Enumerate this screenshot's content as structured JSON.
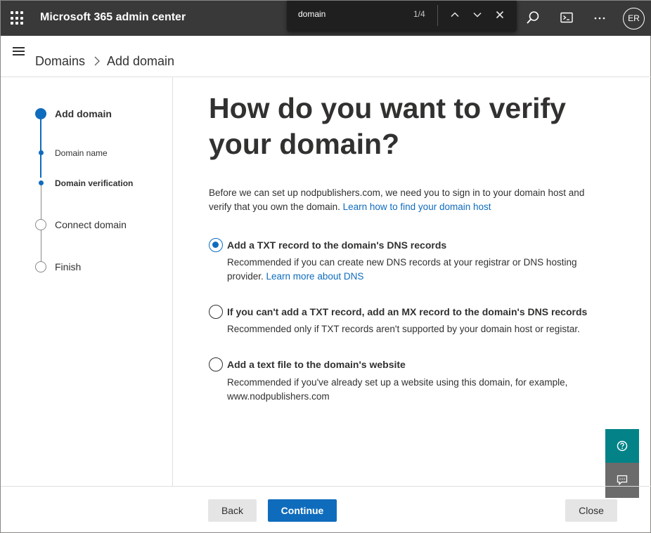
{
  "app": {
    "title": "Microsoft 365 admin center",
    "avatar_initials": "ER"
  },
  "find_bar": {
    "query": "domain",
    "count": "1/4"
  },
  "topbar_icons": [
    "app-launcher-icon",
    "search-icon",
    "terminal-icon",
    "more-icon"
  ],
  "breadcrumb": {
    "parent": "Domains",
    "current": "Add domain"
  },
  "stepper": {
    "steps": [
      {
        "label": "Add domain",
        "state": "active"
      },
      {
        "label": "Domain name",
        "state": "completed-sub"
      },
      {
        "label": "Domain verification",
        "state": "current-sub"
      },
      {
        "label": "Connect domain",
        "state": "upcoming"
      },
      {
        "label": "Finish",
        "state": "upcoming"
      }
    ]
  },
  "main": {
    "heading": "How do you want to verify your domain?",
    "intro_text": "Before we can set up nodpublishers.com, we need you to sign in to your domain host and verify that you own the domain. ",
    "intro_link": "Learn how to find your domain host",
    "options": [
      {
        "title": "Add a TXT record to the domain's DNS records",
        "desc": "Recommended if you can create new DNS records at your registrar or DNS hosting provider. ",
        "link": "Learn more about DNS",
        "selected": true
      },
      {
        "title": "If you can't add a TXT record, add an MX record to the domain's DNS records",
        "desc": "Recommended only if TXT records aren't supported by your domain host or registar.",
        "selected": false
      },
      {
        "title": "Add a text file to the domain's website",
        "desc": "Recommended if you've already set up a website using this domain, for example, www.nodpublishers.com",
        "selected": false
      }
    ]
  },
  "footer": {
    "back_label": "Back",
    "continue_label": "Continue",
    "close_label": "Close"
  },
  "colors": {
    "accent": "#0f6cbd",
    "topbar": "#393939",
    "help_button": "#038387",
    "feedback_button": "#6b6b6b"
  }
}
